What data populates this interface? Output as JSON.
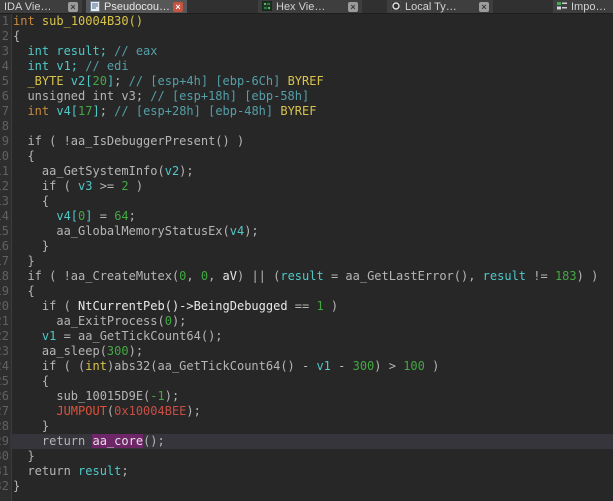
{
  "tabs": {
    "close_glyph": "×",
    "items": [
      {
        "label": "IDA Vie…"
      },
      {
        "label": "Pseudocou…"
      },
      {
        "label": "Hex Vie…"
      },
      {
        "label": "Local Ty…"
      },
      {
        "label": "Impo…"
      }
    ]
  },
  "colors": {
    "bg": "#272727",
    "tabbar-bg": "#303030",
    "tab-bg": "#3e3e3e",
    "tab-active-bg": "#575757",
    "tab-text": "#d2d2d2",
    "close-bg": "#9b9b9b",
    "close-x": "#3a3a3a",
    "close-active-bg": "#c75240",
    "close-active-x": "#ffffff",
    "gutter-bg": "#2e2e2e",
    "gutter-border": "#3c3c3c",
    "gutter-num": "#616161",
    "row-hl": "#35353b",
    "hl-bg": "#6f2668",
    "hl-text": "#e2e2e2",
    "tk-g": "#b5b5b5",
    "tk-w": "#e9e9e9",
    "tk-c": "#4fc8c8",
    "tk-m": "#549fa8",
    "tk-y": "#d8c34c",
    "tk-o": "#c98a3b",
    "tk-n": "#43a843",
    "tk-r": "#e0513b",
    "tk-ra": "#c74f45"
  },
  "code": {
    "lines": [
      {
        "num": 1,
        "tokens": [
          [
            "o",
            "int"
          ],
          [
            "g",
            " "
          ],
          [
            "y",
            "sub_10004B30()"
          ]
        ]
      },
      {
        "num": 2,
        "tokens": [
          [
            "g",
            "{"
          ]
        ]
      },
      {
        "num": 3,
        "tokens": [
          [
            "c",
            "  int result;"
          ],
          [
            "m",
            " // eax"
          ]
        ]
      },
      {
        "num": 4,
        "tokens": [
          [
            "c",
            "  int v1;"
          ],
          [
            "m",
            " // edi"
          ]
        ]
      },
      {
        "num": 5,
        "tokens": [
          [
            "y",
            "  _BYTE"
          ],
          [
            "c",
            " v2["
          ],
          [
            "n",
            "20"
          ],
          [
            "c",
            "]"
          ],
          [
            "g",
            ";"
          ],
          [
            "m",
            " // [esp+4h] [ebp-6Ch]"
          ],
          [
            "y",
            " BYREF"
          ]
        ]
      },
      {
        "num": 6,
        "tokens": [
          [
            "g",
            "  unsigned int v3;"
          ],
          [
            "m",
            " // [esp+18h] [ebp-58h]"
          ]
        ]
      },
      {
        "num": 7,
        "tokens": [
          [
            "o",
            "  int"
          ],
          [
            "c",
            " v4["
          ],
          [
            "n",
            "17"
          ],
          [
            "c",
            "]"
          ],
          [
            "g",
            ";"
          ],
          [
            "m",
            " // [esp+28h] [ebp-48h]"
          ],
          [
            "y",
            " BYREF"
          ]
        ]
      },
      {
        "num": 8,
        "tokens": []
      },
      {
        "num": 9,
        "tokens": [
          [
            "g",
            "  if ( !aa_IsDebuggerPresent() )"
          ]
        ]
      },
      {
        "num": 10,
        "tokens": [
          [
            "g",
            "  {"
          ]
        ]
      },
      {
        "num": 11,
        "tokens": [
          [
            "g",
            "    aa_GetSystemInfo("
          ],
          [
            "c",
            "v2"
          ],
          [
            "g",
            ");"
          ]
        ]
      },
      {
        "num": 12,
        "tokens": [
          [
            "g",
            "    if ( "
          ],
          [
            "c",
            "v3"
          ],
          [
            "g",
            " >= "
          ],
          [
            "n",
            "2"
          ],
          [
            "g",
            " )"
          ]
        ]
      },
      {
        "num": 13,
        "tokens": [
          [
            "g",
            "    {"
          ]
        ]
      },
      {
        "num": 14,
        "tokens": [
          [
            "c",
            "      v4["
          ],
          [
            "n",
            "0"
          ],
          [
            "c",
            "]"
          ],
          [
            "g",
            " = "
          ],
          [
            "n",
            "64"
          ],
          [
            "g",
            ";"
          ]
        ]
      },
      {
        "num": 15,
        "tokens": [
          [
            "g",
            "      aa_GlobalMemoryStatusEx("
          ],
          [
            "c",
            "v4"
          ],
          [
            "g",
            ");"
          ]
        ]
      },
      {
        "num": 16,
        "tokens": [
          [
            "g",
            "    }"
          ]
        ]
      },
      {
        "num": 17,
        "tokens": [
          [
            "g",
            "  }"
          ]
        ]
      },
      {
        "num": 18,
        "tokens": [
          [
            "g",
            "  if ( !aa_CreateMutex("
          ],
          [
            "n",
            "0"
          ],
          [
            "g",
            ", "
          ],
          [
            "n",
            "0"
          ],
          [
            "g",
            ", "
          ],
          [
            "w",
            "aV"
          ],
          [
            "g",
            ") || ("
          ],
          [
            "c",
            "result"
          ],
          [
            "g",
            " = aa_GetLastError(), "
          ],
          [
            "c",
            "result"
          ],
          [
            "g",
            " != "
          ],
          [
            "n",
            "183"
          ],
          [
            "g",
            ") )"
          ]
        ]
      },
      {
        "num": 19,
        "tokens": [
          [
            "g",
            "  {"
          ]
        ]
      },
      {
        "num": 20,
        "tokens": [
          [
            "g",
            "    if ( "
          ],
          [
            "w",
            "NtCurrentPeb()->BeingDebugged"
          ],
          [
            "g",
            " == "
          ],
          [
            "n",
            "1"
          ],
          [
            "g",
            " )"
          ]
        ]
      },
      {
        "num": 21,
        "tokens": [
          [
            "g",
            "      aa_ExitProcess("
          ],
          [
            "n",
            "0"
          ],
          [
            "g",
            ");"
          ]
        ]
      },
      {
        "num": 22,
        "tokens": [
          [
            "c",
            "    v1"
          ],
          [
            "g",
            " = aa_GetTickCount64();"
          ]
        ]
      },
      {
        "num": 23,
        "tokens": [
          [
            "g",
            "    aa_sleep("
          ],
          [
            "n",
            "300"
          ],
          [
            "g",
            ");"
          ]
        ]
      },
      {
        "num": 24,
        "tokens": [
          [
            "g",
            "    if ( ("
          ],
          [
            "y",
            "int"
          ],
          [
            "g",
            ")abs32(aa_GetTickCount64() - "
          ],
          [
            "c",
            "v1"
          ],
          [
            "g",
            " - "
          ],
          [
            "n",
            "300"
          ],
          [
            "g",
            ") > "
          ],
          [
            "n",
            "100"
          ],
          [
            "g",
            " )"
          ]
        ]
      },
      {
        "num": 25,
        "tokens": [
          [
            "g",
            "    {"
          ]
        ]
      },
      {
        "num": 26,
        "tokens": [
          [
            "g",
            "      sub_10015D9E("
          ],
          [
            "n",
            "-1"
          ],
          [
            "g",
            ");"
          ]
        ]
      },
      {
        "num": 27,
        "tokens": [
          [
            "r",
            "      JUMPOUT"
          ],
          [
            "g",
            "("
          ],
          [
            "ra",
            "0x10004BEE"
          ],
          [
            "g",
            ");"
          ]
        ]
      },
      {
        "num": 28,
        "tokens": [
          [
            "g",
            "    }"
          ]
        ]
      },
      {
        "num": 29,
        "highlight_row": true,
        "tokens": [
          [
            "g",
            "    return "
          ],
          [
            "hl",
            "aa_core"
          ],
          [
            "g",
            "();"
          ]
        ]
      },
      {
        "num": 30,
        "tokens": [
          [
            "g",
            "  }"
          ]
        ]
      },
      {
        "num": 31,
        "tokens": [
          [
            "g",
            "  return "
          ],
          [
            "c",
            "result"
          ],
          [
            "g",
            ";"
          ]
        ]
      },
      {
        "num": 32,
        "tokens": [
          [
            "g",
            "}"
          ]
        ]
      }
    ]
  }
}
